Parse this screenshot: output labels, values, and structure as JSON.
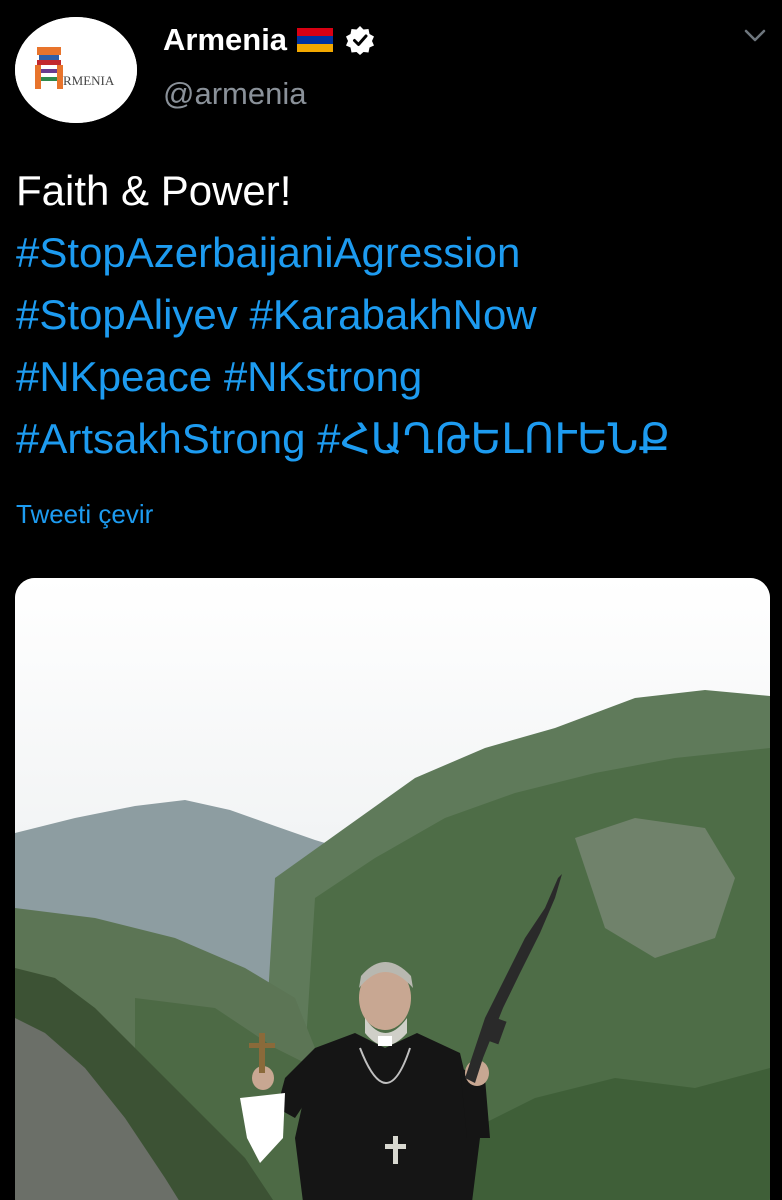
{
  "user": {
    "display_name": "Armenia",
    "handle": "@armenia",
    "flag_icon": "armenia-flag-icon",
    "verified_icon": "verified-badge-icon",
    "avatar_text": "RMENIA"
  },
  "tweet": {
    "line1": "Faith & Power!",
    "line2": "#StopAzerbaijaniAgression",
    "line3_tag1": "#StopAliyev",
    "line3_tag2": "#KarabakhNow",
    "line4_tag1": "#NKpeace",
    "line4_tag2": "#NKstrong",
    "line5_tag1": "#ArtsakhStrong",
    "line5_tag2": "#ՀԱՂԹԵԼՈՒԵՆՔ",
    "translate_label": "Tweeti çevir"
  },
  "colors": {
    "background": "#000000",
    "text": "#ffffff",
    "link": "#1d9bf0",
    "secondary": "#8a9199"
  },
  "icons": {
    "more": "chevron-down-icon"
  }
}
